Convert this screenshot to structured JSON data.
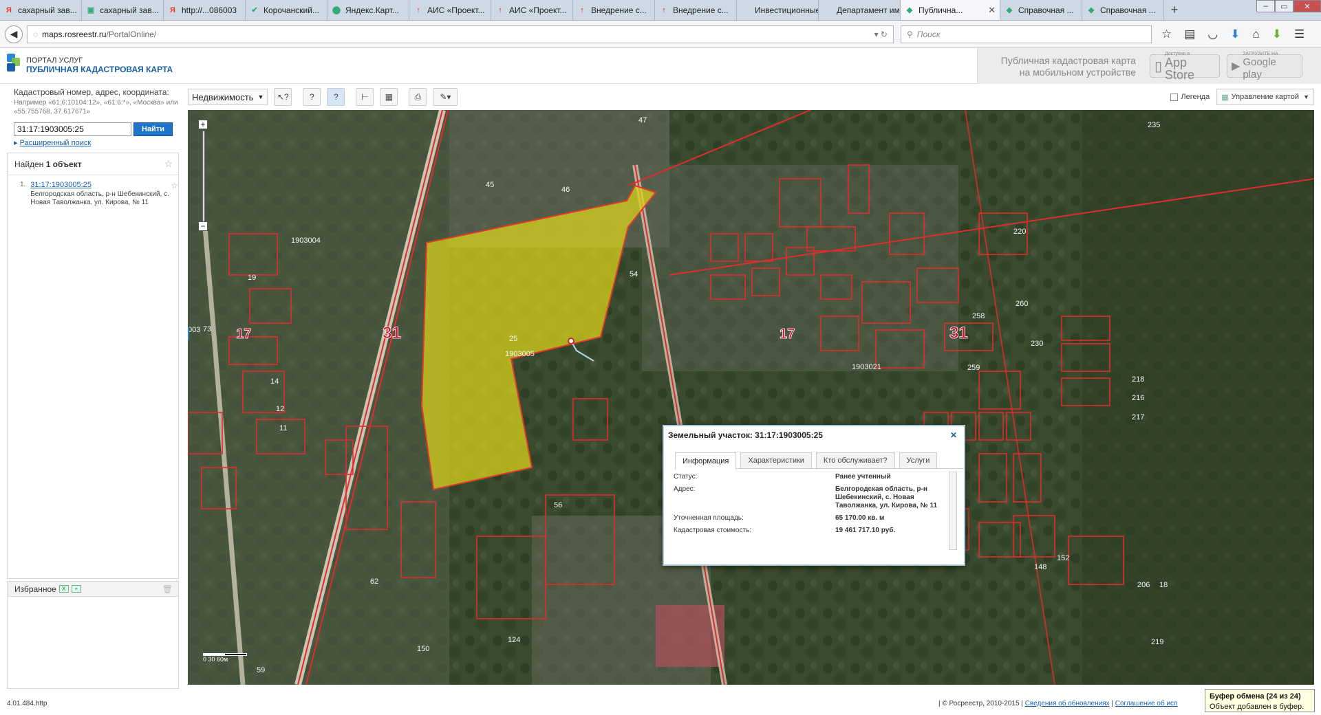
{
  "browser": {
    "tabs": [
      {
        "label": "сахарный зав...",
        "icon": "Я"
      },
      {
        "label": "сахарный зав...",
        "icon": "▣"
      },
      {
        "label": "http://...086003",
        "icon": "Я"
      },
      {
        "label": "Корочанский...",
        "icon": "✔"
      },
      {
        "label": "Яндекс.Карт...",
        "icon": "⬤"
      },
      {
        "label": "АИС «Проект...",
        "icon": "↑"
      },
      {
        "label": "АИС «Проект...",
        "icon": "↑"
      },
      {
        "label": "Внедрение с...",
        "icon": "↑"
      },
      {
        "label": "Внедрение с...",
        "icon": "↑"
      },
      {
        "label": "Инвестиционные...",
        "icon": ""
      },
      {
        "label": "Департамент им...",
        "icon": ""
      },
      {
        "label": "Публична...",
        "icon": "◆",
        "active": true
      },
      {
        "label": "Справочная ...",
        "icon": "◆"
      },
      {
        "label": "Справочная ...",
        "icon": "◆"
      }
    ],
    "url_host": "maps.rosreestr.ru",
    "url_path": "/PortalOnline/",
    "search_placeholder": "Поиск"
  },
  "header": {
    "logo_line1": "ПОРТАЛ УСЛУГ",
    "logo_line2": "ПУБЛИЧНАЯ КАДАСТРОВАЯ КАРТА",
    "mobile_text": "Публичная кадастровая карта на мобильном устройстве",
    "appstore_small": "Доступно в",
    "appstore_big": "App Store",
    "gplay_small": "ЗАГРУЗИТЕ НА",
    "gplay_big": "Google play"
  },
  "search": {
    "title": "Кадастровый номер, адрес, координата:",
    "hint": "Например «61:6:10104:12», «61:6:*», «Москва» или «55.755768, 37.617671»",
    "value": "31:17:1903005:25",
    "button": "Найти",
    "advanced": "Расширенный поиск"
  },
  "results": {
    "found_prefix": "Найден ",
    "found_count": "1 объект",
    "items": [
      {
        "num": "1.",
        "link": "31:17:1903005:25",
        "address": "Белгородская область, р-н Шебекинский, с. Новая Таволжанка, ул. Кирова, № 11"
      }
    ]
  },
  "favorites": {
    "label": "Избранное"
  },
  "toolbar": {
    "layer_select": "Недвижимость",
    "legend": "Легенда",
    "map_control": "Управление картой"
  },
  "map": {
    "labels": [
      "1903004",
      "1903005",
      "1903021",
      "31",
      "31",
      "17",
      "17",
      "25",
      "45",
      "46",
      "47",
      "54",
      "56",
      "62",
      "124",
      "150",
      "260",
      "258",
      "230",
      "220",
      "259",
      "235",
      "216",
      "217",
      "218",
      "148",
      "152",
      "206",
      "18",
      "219",
      "59",
      "73",
      "19",
      "14",
      "12",
      "11",
      "003"
    ],
    "scale": "0   30   60м"
  },
  "popup": {
    "title": "Земельный участок: 31:17:1903005:25",
    "tabs": [
      "Информация",
      "Характеристики",
      "Кто обслуживает?",
      "Услуги"
    ],
    "rows": [
      {
        "k": "Статус:",
        "v": "Ранее учтенный"
      },
      {
        "k": "Адрес:",
        "v": "Белгородская область, р-н Шебекинский, с. Новая Таволжанка, ул. Кирова, № 11"
      },
      {
        "k": "Уточненная площадь:",
        "v": "65 170.00 кв. м"
      },
      {
        "k": "Кадастровая стоимость:",
        "v": "19 461 717.10 руб."
      }
    ]
  },
  "status": {
    "version": "4.01.484.http",
    "copyright": "| © Росреестр, 2010-2015 |",
    "link1": "Сведения об обновлениях",
    "link2": "Соглашение об исп"
  },
  "clipboard": {
    "title": "Буфер обмена (24 из 24)",
    "text": "Объект добавлен в буфер."
  }
}
